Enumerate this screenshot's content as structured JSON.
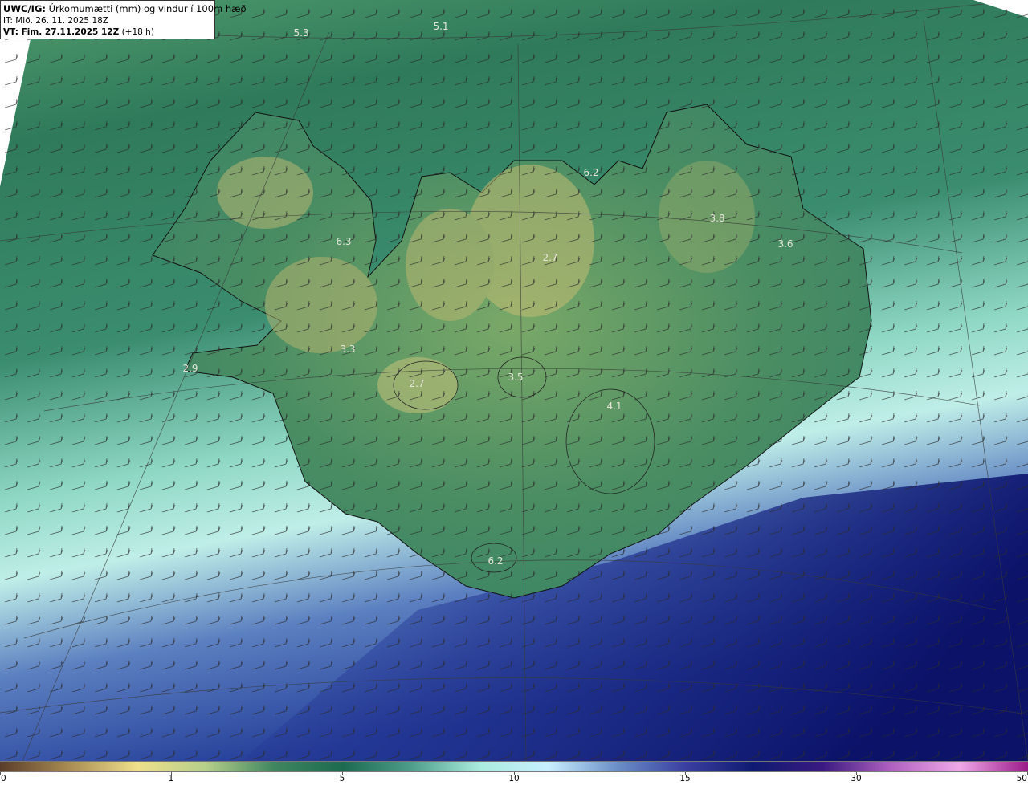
{
  "header": {
    "title_bold": "UWC/IG:",
    "title_rest": " Úrkomumætti (mm) og vindur í 100m hæð",
    "init_time": "IT: Mið. 26. 11. 2025 18Z",
    "valid_prefix": "VT: Fim. 27.11.2025 12Z",
    "valid_suffix": " (+18 h)"
  },
  "map_labels": [
    {
      "id": "label-5-3",
      "text": "5.3"
    },
    {
      "id": "label-5-1",
      "text": "5.1"
    },
    {
      "id": "label-6-2-north",
      "text": "6.2"
    },
    {
      "id": "label-3-8",
      "text": "3.8"
    },
    {
      "id": "label-3-6",
      "text": "3.6"
    },
    {
      "id": "label-6-3",
      "text": "6.3"
    },
    {
      "id": "label-2-7-north",
      "text": "2.7"
    },
    {
      "id": "label-3-3",
      "text": "3.3"
    },
    {
      "id": "label-2-9",
      "text": "2.9"
    },
    {
      "id": "label-2-7-west",
      "text": "2.7"
    },
    {
      "id": "label-3-5",
      "text": "3.5"
    },
    {
      "id": "label-4-1",
      "text": "4.1"
    },
    {
      "id": "label-6-2-south",
      "text": "6.2"
    }
  ],
  "colorbar": {
    "ticks": [
      "0",
      "1",
      "5",
      "10",
      "15",
      "30",
      "50"
    ],
    "colors": [
      "#5a3d2b",
      "#a88b52",
      "#efe08c",
      "#b6cf8a",
      "#3f8660",
      "#1c6a50",
      "#4e9d8a",
      "#a9ecde",
      "#c8efff",
      "#6b8fc8",
      "#3a3fa0",
      "#0e1a70",
      "#3a1a80",
      "#b060c0",
      "#f0a8e8",
      "#9a1a8a"
    ]
  },
  "colors": {
    "ocean_north": "#3d8a64",
    "land_high": "#a8b56a",
    "ocean_south_light": "#bfeee8",
    "ocean_south_deep": "#17207a",
    "coastline": "#111111"
  }
}
